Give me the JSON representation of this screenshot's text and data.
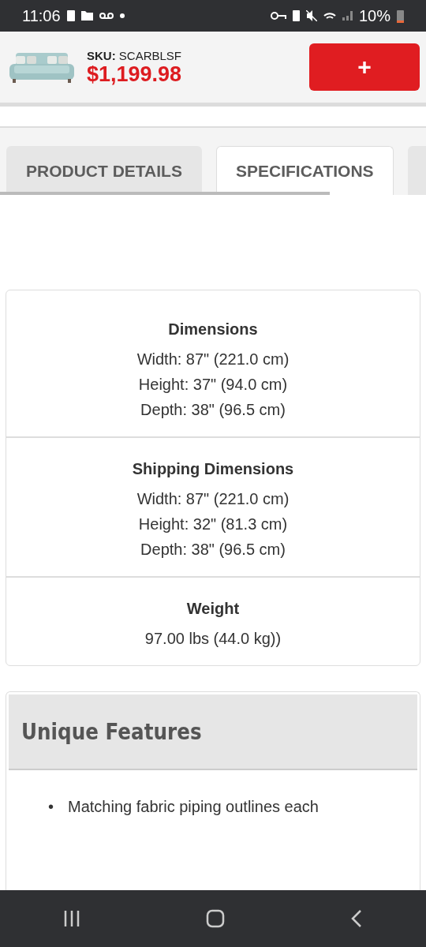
{
  "status_bar": {
    "time": "11:06",
    "battery": "10%"
  },
  "header": {
    "sku_label": "SKU:",
    "sku": "SCARBLSF",
    "price": "$1,199.98",
    "add_button": "+"
  },
  "tabs": [
    {
      "label": "PRODUCT DETAILS",
      "selected": false
    },
    {
      "label": "SPECIFICATIONS",
      "selected": true
    },
    {
      "selected": false
    }
  ],
  "specs": [
    {
      "title": "Dimensions",
      "lines": [
        "Width: 87\" (221.0 cm)",
        "Height: 37\" (94.0 cm)",
        "Depth: 38\" (96.5 cm)"
      ]
    },
    {
      "title": "Shipping Dimensions",
      "lines": [
        "Width: 87\" (221.0 cm)",
        "Height: 32\" (81.3 cm)",
        "Depth: 38\" (96.5 cm)"
      ]
    },
    {
      "title": "Weight",
      "lines": [
        "97.00 lbs (44.0 kg))"
      ]
    }
  ],
  "features": {
    "title": "Unique Features",
    "items": [
      {
        "marker": "•",
        "text": "Matching fabric piping outlines each"
      }
    ]
  }
}
